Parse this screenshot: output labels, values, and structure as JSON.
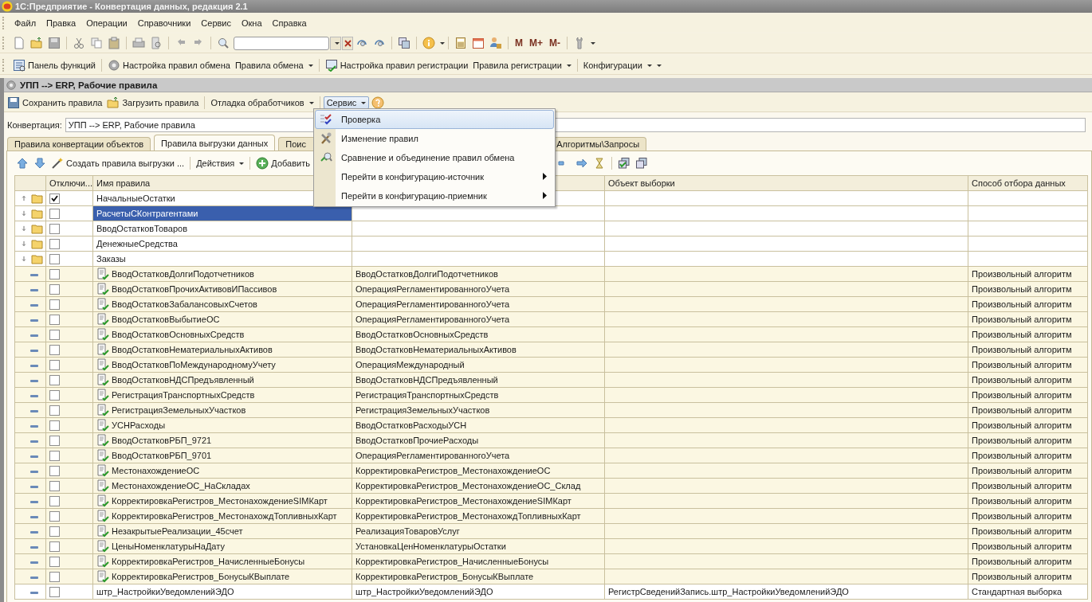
{
  "window": {
    "title": "1С:Предприятие - Конвертация данных, редакция 2.1"
  },
  "menu_bar": [
    "Файл",
    "Правка",
    "Операции",
    "Справочники",
    "Сервис",
    "Окна",
    "Справка"
  ],
  "toolbar": {
    "memory_buttons": [
      "M",
      "M+",
      "M-"
    ]
  },
  "function_bar": [
    {
      "label": "Панель функций",
      "dropdown": false
    },
    {
      "label": "Настройка правил обмена",
      "dropdown": false
    },
    {
      "label": "Правила обмена",
      "dropdown": true
    },
    {
      "label": "Настройка правил регистрации",
      "dropdown": false
    },
    {
      "label": "Правила регистрации",
      "dropdown": true
    },
    {
      "label": "Конфигурации",
      "dropdown": true
    }
  ],
  "document": {
    "title": "УПП --> ERP, Рабочие правила",
    "toolbar": [
      {
        "label": "Сохранить правила",
        "dropdown": false,
        "pressed": false
      },
      {
        "label": "Загрузить правила",
        "dropdown": false,
        "pressed": false
      },
      {
        "label": "Отладка обработчиков",
        "dropdown": true,
        "pressed": false
      },
      {
        "label": "Сервис",
        "dropdown": true,
        "pressed": true
      }
    ],
    "conversion": {
      "label": "Конвертация:",
      "value": "УПП --> ERP, Рабочие правила"
    },
    "tabs": [
      {
        "label": "Правила конвертации объектов",
        "selected": false
      },
      {
        "label": "Правила выгрузки данных",
        "selected": true
      },
      {
        "label": "Поис",
        "selected": false
      },
      {
        "label": "Алгоритмы\\Запросы",
        "selected": false
      }
    ],
    "table_toolbar": [
      {
        "label": "Создать правила выгрузки ...",
        "dropdown": false
      },
      {
        "label": "Действия",
        "dropdown": true
      },
      {
        "label": "Добавить",
        "dropdown": false
      }
    ]
  },
  "table": {
    "columns": {
      "checked": "Отключи...",
      "name": "Имя правила",
      "object": "Объект выборки",
      "method": "Способ отбора данных"
    },
    "rows": [
      {
        "kind": "group",
        "name": "НачальныеОстатки",
        "checked": true,
        "expanded": true,
        "selected": false
      },
      {
        "kind": "group",
        "name": "РасчетыСКонтрагентами",
        "checked": false,
        "expanded": false,
        "selected": true
      },
      {
        "kind": "group",
        "name": "ВводОстатковТоваров",
        "checked": false,
        "expanded": false,
        "selected": false
      },
      {
        "kind": "group",
        "name": "ДенежныеСредства",
        "checked": false,
        "expanded": false,
        "selected": false
      },
      {
        "kind": "group",
        "name": "Заказы",
        "checked": false,
        "expanded": false,
        "selected": false
      },
      {
        "kind": "rule",
        "name": "ВводОстатковДолгиПодотчетников",
        "source": "ВводОстатковДолгиПодотчетников",
        "method": "Произвольный алгоритм",
        "checked": false,
        "selected": false
      },
      {
        "kind": "rule",
        "name": "ВводОстатковПрочихАктивовИПассивов",
        "source": "ОперацияРегламентированногоУчета",
        "method": "Произвольный алгоритм",
        "checked": false,
        "selected": false
      },
      {
        "kind": "rule",
        "name": "ВводОстатковЗабалансовыхСчетов",
        "source": "ОперацияРегламентированногоУчета",
        "method": "Произвольный алгоритм",
        "checked": false,
        "selected": false
      },
      {
        "kind": "rule",
        "name": "ВводОстатковВыбытиеОС",
        "source": "ОперацияРегламентированногоУчета",
        "method": "Произвольный алгоритм",
        "checked": false,
        "selected": false
      },
      {
        "kind": "rule",
        "name": "ВводОстатковОсновныхСредств",
        "source": "ВводОстатковОсновныхСредств",
        "method": "Произвольный алгоритм",
        "checked": false,
        "selected": false
      },
      {
        "kind": "rule",
        "name": "ВводОстатковНематериальныхАктивов",
        "source": "ВводОстатковНематериальныхАктивов",
        "method": "Произвольный алгоритм",
        "checked": false,
        "selected": false
      },
      {
        "kind": "rule",
        "name": "ВводОстатковПоМеждународномуУчету",
        "source": "ОперацияМеждународный",
        "method": "Произвольный алгоритм",
        "checked": false,
        "selected": false
      },
      {
        "kind": "rule",
        "name": "ВводОстатковНДСПредъявленный",
        "source": "ВводОстатковНДСПредъявленный",
        "method": "Произвольный алгоритм",
        "checked": false,
        "selected": false
      },
      {
        "kind": "rule",
        "name": "РегистрацияТранспортныхСредств",
        "source": "РегистрацияТранспортныхСредств",
        "method": "Произвольный алгоритм",
        "checked": false,
        "selected": false
      },
      {
        "kind": "rule",
        "name": "РегистрацияЗемельныхУчастков",
        "source": "РегистрацияЗемельныхУчастков",
        "method": "Произвольный алгоритм",
        "checked": false,
        "selected": false
      },
      {
        "kind": "rule",
        "name": "УСНРасходы",
        "source": "ВводОстатковРасходыУСН",
        "method": "Произвольный алгоритм",
        "checked": false,
        "selected": false
      },
      {
        "kind": "rule",
        "name": "ВводОстатковРБП_9721",
        "source": "ВводОстатковПрочиеРасходы",
        "method": "Произвольный алгоритм",
        "checked": false,
        "selected": false
      },
      {
        "kind": "rule",
        "name": "ВводОстатковРБП_9701",
        "source": "ОперацияРегламентированногоУчета",
        "method": "Произвольный алгоритм",
        "checked": false,
        "selected": false
      },
      {
        "kind": "rule",
        "name": "МестонахождениеОС",
        "source": "КорректировкаРегистров_МестонахождениеОС",
        "method": "Произвольный алгоритм",
        "checked": false,
        "selected": false
      },
      {
        "kind": "rule",
        "name": "МестонахождениеОС_НаСкладах",
        "source": "КорректировкаРегистров_МестонахождениеОС_Склад",
        "method": "Произвольный алгоритм",
        "checked": false,
        "selected": false
      },
      {
        "kind": "rule",
        "name": "КорректировкаРегистров_МестонахождениеSIMКарт",
        "source": "КорректировкаРегистров_МестонахождениеSIMКарт",
        "method": "Произвольный алгоритм",
        "checked": false,
        "selected": false
      },
      {
        "kind": "rule",
        "name": "КорректировкаРегистров_МестонахождТопливныхКарт",
        "source": "КорректировкаРегистров_МестонахождТопливныхКарт",
        "method": "Произвольный алгоритм",
        "checked": false,
        "selected": false
      },
      {
        "kind": "rule",
        "name": "НезакрытыеРеализации_45счет",
        "source": "РеализацияТоваровУслуг",
        "method": "Произвольный алгоритм",
        "checked": false,
        "selected": false
      },
      {
        "kind": "rule",
        "name": "ЦеныНоменклатурыНаДату",
        "source": "УстановкаЦенНоменклатурыОстатки",
        "method": "Произвольный алгоритм",
        "checked": false,
        "selected": false
      },
      {
        "kind": "rule",
        "name": "КорректировкаРегистров_НачисленныеБонусы",
        "source": "КорректировкаРегистров_НачисленныеБонусы",
        "method": "Произвольный алгоритм",
        "checked": false,
        "selected": false
      },
      {
        "kind": "rule",
        "name": "КорректировкаРегистров_БонусыКВыплате",
        "source": "КорректировкаРегистров_БонусыКВыплате",
        "method": "Произвольный алгоритм",
        "checked": false,
        "selected": false
      },
      {
        "kind": "plain",
        "name": "штр_НастройкиУведомленийЭДО",
        "source": "штр_НастройкиУведомленийЭДО",
        "object": "РегистрСведенийЗапись.штр_НастройкиУведомленийЭДО",
        "method": "Стандартная выборка",
        "checked": false,
        "selected": false
      }
    ]
  },
  "service_menu": {
    "items": [
      {
        "label": "Проверка",
        "selected": true,
        "submenu": false
      },
      {
        "label": "Изменение правил",
        "selected": false,
        "submenu": false
      },
      {
        "label": "Сравнение и объединение правил обмена",
        "selected": false,
        "submenu": false
      },
      {
        "label": "Перейти в конфигурацию-источник",
        "selected": false,
        "submenu": true
      },
      {
        "label": "Перейти в конфигурацию-приемник",
        "selected": false,
        "submenu": true
      }
    ]
  }
}
